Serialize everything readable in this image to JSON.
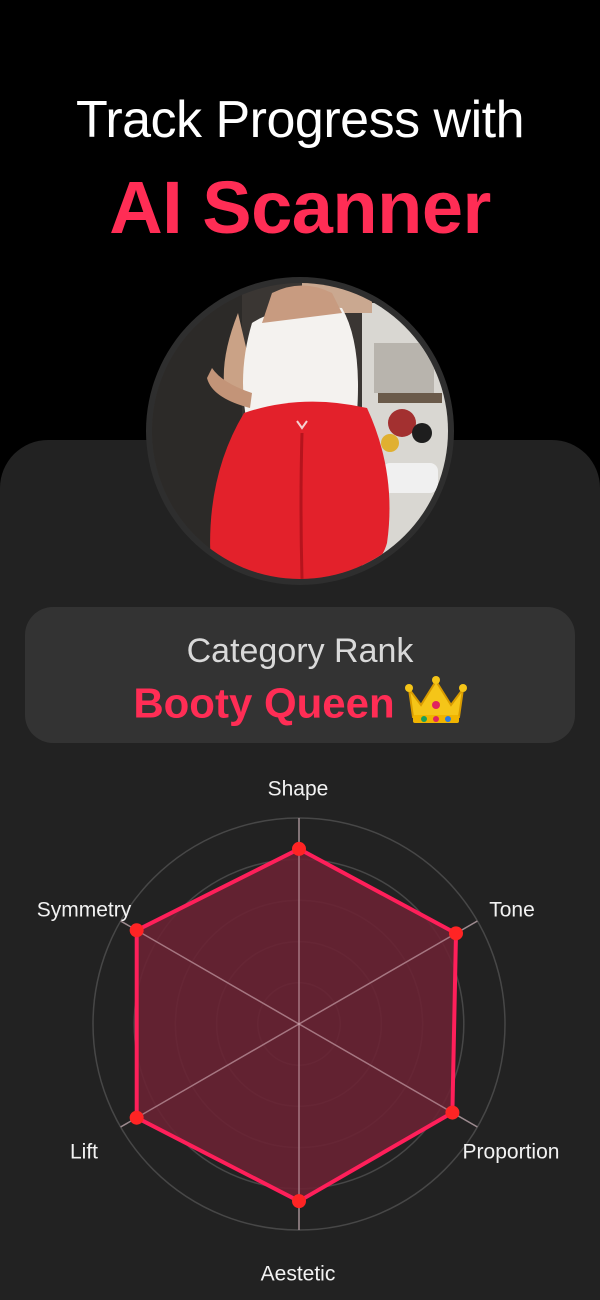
{
  "header": {
    "line1": "Track Progress with",
    "line2": "AI Scanner"
  },
  "colors": {
    "background": "#000000",
    "panel": "#222222",
    "card": "#333333",
    "accent": "#ff2d55",
    "radar_fill": "#6b2233",
    "radar_point": "#ff2424"
  },
  "photo": {
    "subject": "person in red leggings and white top"
  },
  "rank": {
    "title": "Category Rank",
    "value": "Booty Queen",
    "icon": "crown-icon"
  },
  "chart_data": {
    "type": "radar",
    "axes": [
      "Shape",
      "Tone",
      "Proportion",
      "Aestetic",
      "Lift",
      "Symmetry"
    ],
    "values": [
      0.85,
      0.88,
      0.86,
      0.86,
      0.91,
      0.91
    ],
    "range": [
      0,
      1
    ],
    "rings": 5,
    "grid": true
  }
}
